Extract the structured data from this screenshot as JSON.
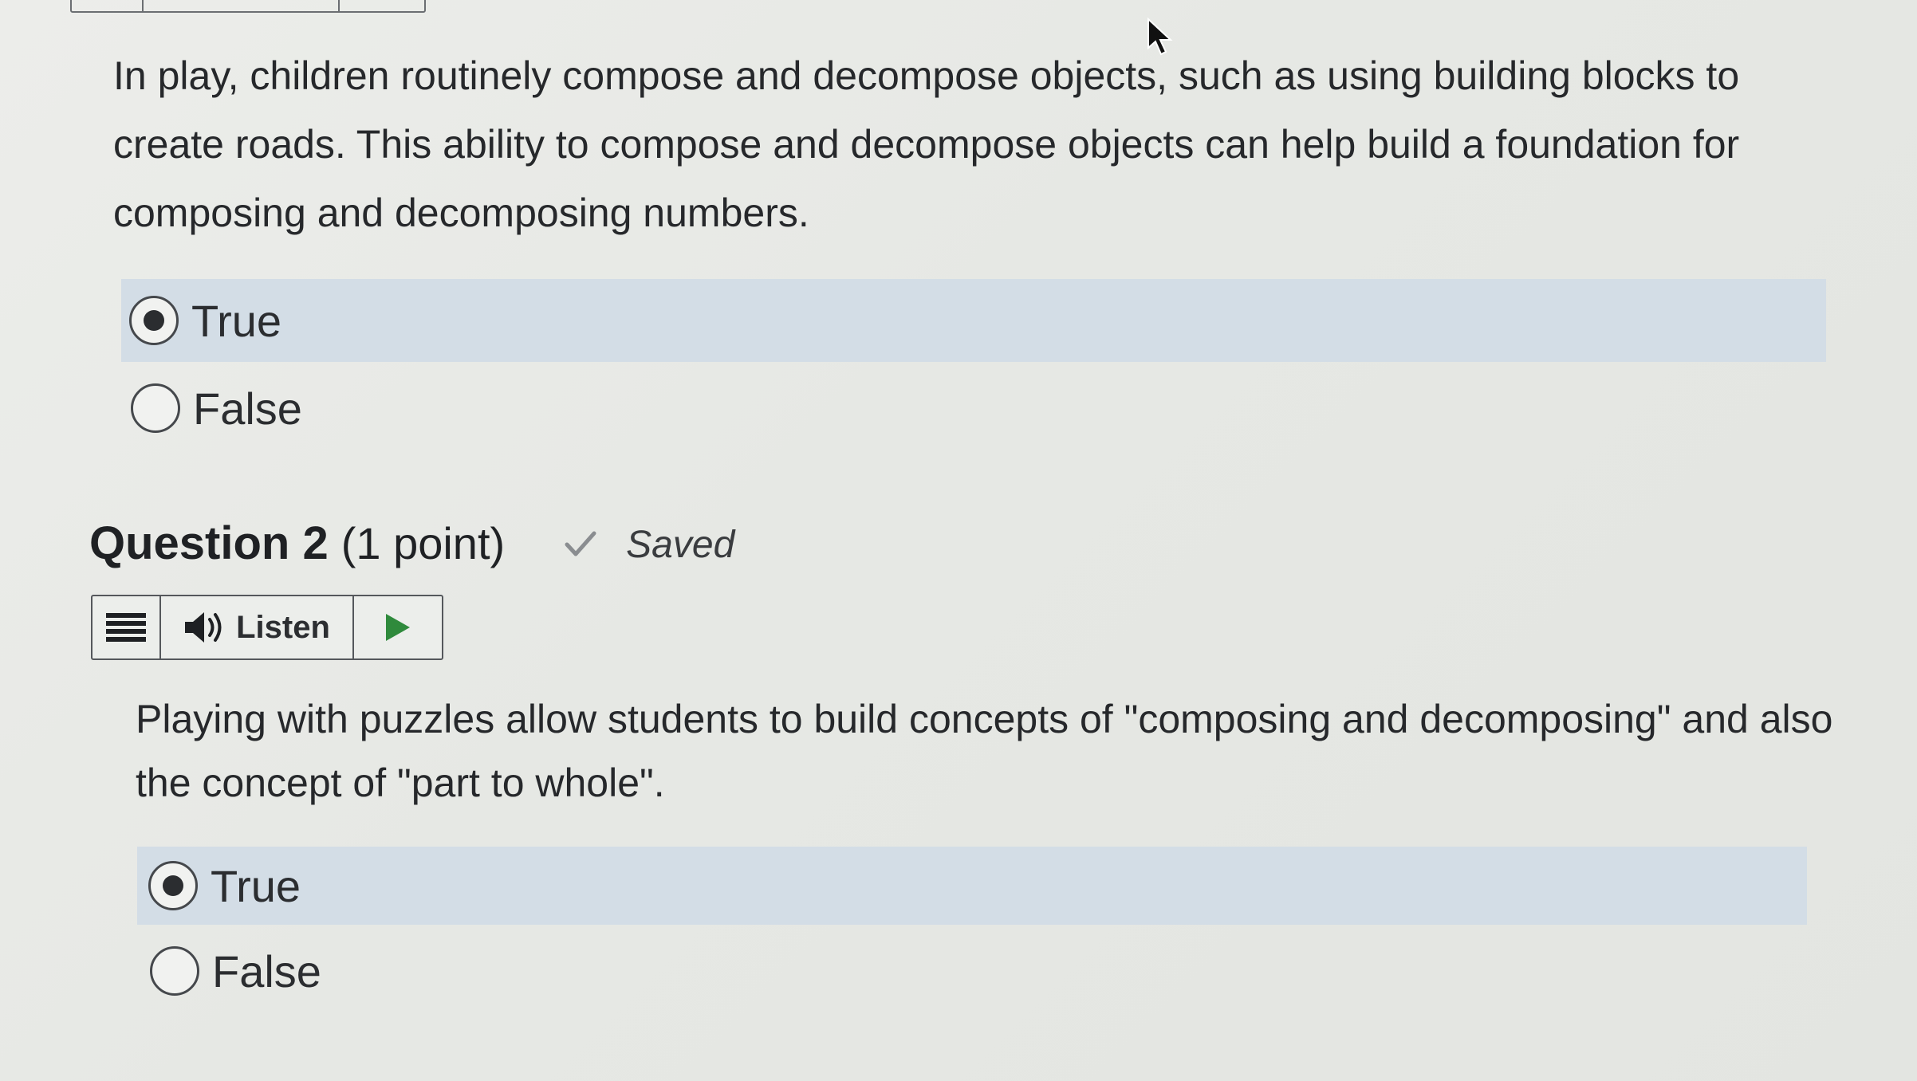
{
  "questions": [
    {
      "text": "In play, children routinely compose and decompose objects, such as using building blocks to create roads.  This ability to compose and decompose objects can help build a foundation for composing and decomposing numbers.",
      "options": [
        {
          "label": "True",
          "selected": true
        },
        {
          "label": "False",
          "selected": false
        }
      ]
    },
    {
      "title": "Question 2",
      "points": "(1 point)",
      "status": "Saved",
      "listen_label": "Listen",
      "text": "Playing with puzzles allow students to build concepts of \"composing and decomposing\" and also the concept of \"part to whole\".",
      "options": [
        {
          "label": "True",
          "selected": true
        },
        {
          "label": "False",
          "selected": false
        }
      ]
    }
  ],
  "colors": {
    "selected_row": "#d3dde6",
    "play_icon": "#2f8a3c",
    "check_icon": "#8a8d90"
  }
}
